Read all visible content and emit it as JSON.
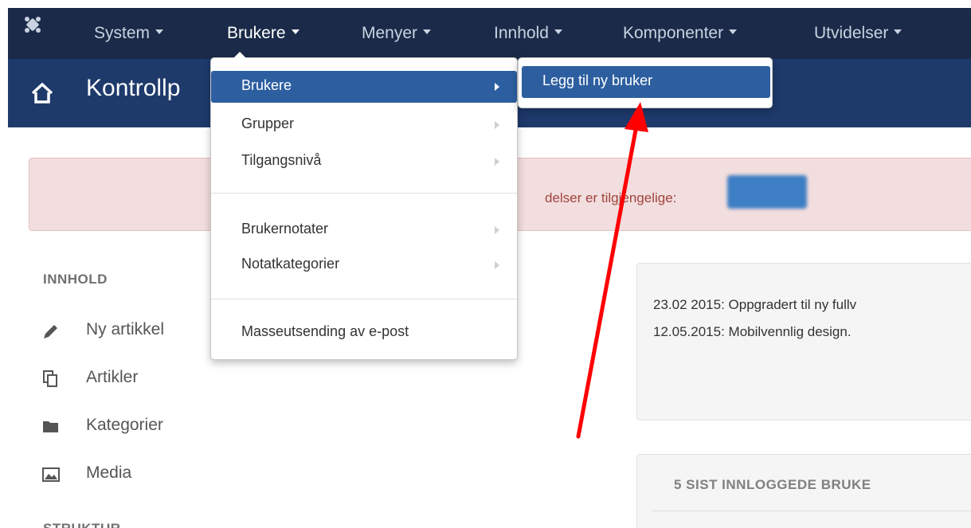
{
  "topnav": {
    "items": [
      {
        "label": "System"
      },
      {
        "label": "Brukere"
      },
      {
        "label": "Menyer"
      },
      {
        "label": "Innhold"
      },
      {
        "label": "Komponenter"
      },
      {
        "label": "Utvidelser"
      }
    ]
  },
  "header": {
    "title": "Kontrollp"
  },
  "alert": {
    "text": "delser er tilgjengelige:"
  },
  "sidebar": {
    "innhold_heading": "INNHOLD",
    "items": [
      {
        "label": "Ny artikkel",
        "icon": "pencil-icon"
      },
      {
        "label": "Artikler",
        "icon": "copy-icon"
      },
      {
        "label": "Kategorier",
        "icon": "folder-icon"
      },
      {
        "label": "Media",
        "icon": "image-icon"
      }
    ],
    "struktur_heading": "STRUKTUR"
  },
  "news": {
    "lines": [
      "23.02 2015: Oppgradert til ny fullv",
      "12.05.2015: Mobilvennlig design."
    ]
  },
  "users_panel": {
    "heading": "5 SIST INNLOGGEDE BRUKE"
  },
  "dropdown": {
    "items": [
      {
        "label": "Brukere"
      },
      {
        "label": "Grupper"
      },
      {
        "label": "Tilgangsnivå"
      },
      {
        "label": "Brukernotater"
      },
      {
        "label": "Notatkategorier"
      },
      {
        "label": "Masseutsending av e-post"
      }
    ]
  },
  "submenu": {
    "item": "Legg til ny bruker"
  },
  "colors": {
    "topnav_bg": "#1a2a48",
    "header_bg": "#1e3a6b",
    "highlight": "#2d5fa0",
    "arrow": "#ff0000"
  }
}
